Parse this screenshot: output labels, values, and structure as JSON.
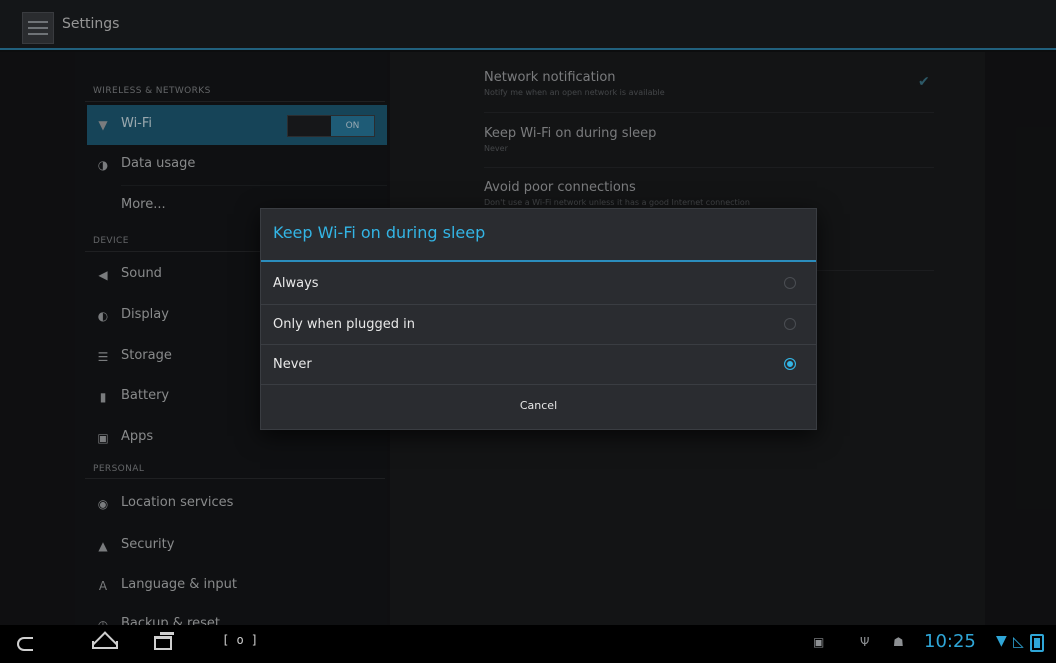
{
  "app": {
    "title": "Settings"
  },
  "left_menu": {
    "sections": [
      {
        "header": "WIRELESS & NETWORKS",
        "items": [
          {
            "id": "wifi",
            "label": "Wi-Fi",
            "icon": "wifi-icon",
            "selected": true,
            "toggle_label": "ON"
          },
          {
            "id": "data_usage",
            "label": "Data usage",
            "icon": "data-usage-icon"
          },
          {
            "id": "more",
            "label": "More...",
            "icon": null
          }
        ]
      },
      {
        "header": "DEVICE",
        "items": [
          {
            "id": "sound",
            "label": "Sound",
            "icon": "speaker-icon"
          },
          {
            "id": "display",
            "label": "Display",
            "icon": "display-icon"
          },
          {
            "id": "storage",
            "label": "Storage",
            "icon": "storage-icon"
          },
          {
            "id": "battery",
            "label": "Battery",
            "icon": "battery-icon"
          },
          {
            "id": "apps",
            "label": "Apps",
            "icon": "apps-icon"
          }
        ]
      },
      {
        "header": "PERSONAL",
        "items": [
          {
            "id": "location",
            "label": "Location services",
            "icon": "location-icon"
          },
          {
            "id": "security",
            "label": "Security",
            "icon": "lock-icon"
          },
          {
            "id": "language",
            "label": "Language & input",
            "icon": "language-icon"
          },
          {
            "id": "backup",
            "label": "Backup & reset",
            "icon": "backup-icon"
          }
        ]
      }
    ]
  },
  "right_settings": [
    {
      "title": "Network notification",
      "summary": "Notify me when an open network is available",
      "checked": true
    },
    {
      "title": "Keep Wi-Fi on during sleep",
      "summary": "Never"
    },
    {
      "title": "Avoid poor connections",
      "summary": "Don't use a Wi-Fi network unless it has a good Internet connection"
    }
  ],
  "dialog": {
    "title": "Keep Wi-Fi on during sleep",
    "options": [
      {
        "label": "Always",
        "selected": false
      },
      {
        "label": "Only when plugged in",
        "selected": false
      },
      {
        "label": "Never",
        "selected": true
      }
    ],
    "cancel_label": "Cancel"
  },
  "navbar": {
    "buttons": [
      "back-icon",
      "home-icon",
      "recent-apps-icon",
      "screenshot-icon"
    ],
    "status": {
      "time": "10:25",
      "icons": [
        "picture-notification-icon",
        "usb-icon",
        "android-debug-icon",
        "wifi-signal-icon",
        "mobile-signal-icon",
        "battery-charging-icon"
      ]
    }
  },
  "colors": {
    "accent": "#33b5e5",
    "selected_bg": "#1f5f7a",
    "dialog_bg": "#2a2c30",
    "background": "#111214"
  }
}
